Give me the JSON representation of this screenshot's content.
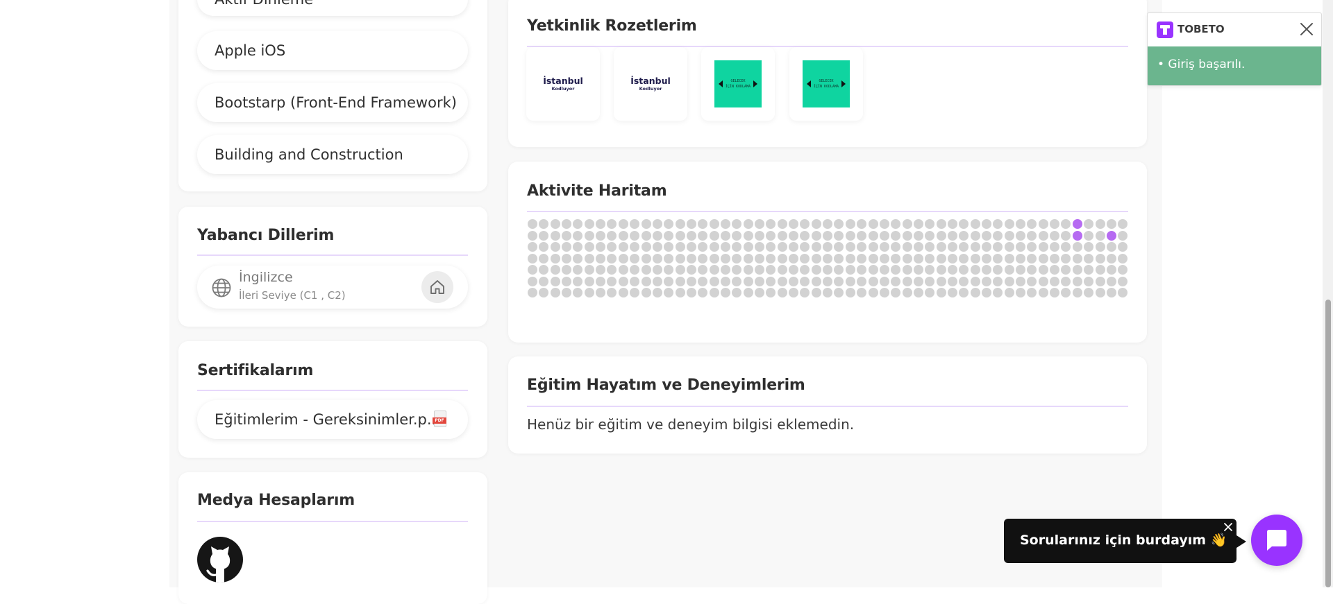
{
  "skills": {
    "items": [
      "Aktif Dinleme",
      "Apple iOS",
      "Bootstarp (Front-End Framework)",
      "Building and Construction"
    ]
  },
  "languages": {
    "title": "Yabancı Dillerim",
    "items": [
      {
        "name": "İngilizce",
        "level": "İleri Seviye (C1 , C2)"
      }
    ]
  },
  "certificates": {
    "title": "Sertifikalarım",
    "items": [
      {
        "file": "Eğitimlerim - Gereksinimler.p...",
        "badge": "PDF"
      }
    ]
  },
  "media": {
    "title": "Medya Hesaplarım",
    "accounts": [
      {
        "icon": "github-icon"
      }
    ]
  },
  "badges": {
    "title": "Yetkinlik Rozetlerim",
    "items": [
      {
        "line1": "İstanbul",
        "line2": "Kodluyor",
        "style": "light"
      },
      {
        "line1": "İstanbul",
        "line2": "Kodluyor",
        "style": "light"
      },
      {
        "line1": "GELECEK",
        "line2": "İÇİN KODLAMA",
        "style": "green"
      },
      {
        "line1": "GELECEK",
        "line2": "İÇİN KODLAMA",
        "style": "green"
      }
    ]
  },
  "activity": {
    "title": "Aktivite Haritam",
    "columns": 53,
    "rows": 7,
    "active_cells": [
      {
        "col": 48,
        "row": 0,
        "level": 1
      },
      {
        "col": 48,
        "row": 1,
        "level": 1
      },
      {
        "col": 51,
        "row": 1,
        "level": 1
      }
    ],
    "legend_colors": [
      "#c8c8c8",
      "#b66bf2",
      "#9b3be6",
      "#5c1f99",
      "#3a135f"
    ],
    "empty_color": "#d2d2d2"
  },
  "education": {
    "title": "Eğitim Hayatım ve Deneyimlerim",
    "empty_text": "Henüz bir eğitim ve deneyim bilgisi eklemedin."
  },
  "toast": {
    "brand": "TOBETO",
    "message": "• Giriş başarılı.",
    "accent": "#6bb58e"
  },
  "chat": {
    "bubble_text": "Sorularınız için burdayım 👋",
    "button_color": "#9933ff"
  },
  "colors": {
    "purple": "#9933ff",
    "divider": "#e7d8fb"
  }
}
